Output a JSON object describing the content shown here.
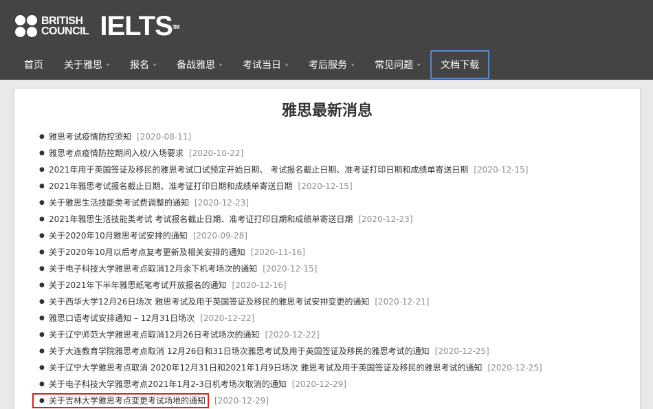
{
  "header": {
    "brand_line1": "BRITISH",
    "brand_line2": "COUNCIL",
    "product": "IELTS",
    "tm": "TM"
  },
  "nav": {
    "items": [
      {
        "label": "首页",
        "dropdown": false
      },
      {
        "label": "关于雅思",
        "dropdown": true
      },
      {
        "label": "报名",
        "dropdown": true
      },
      {
        "label": "备战雅思",
        "dropdown": true
      },
      {
        "label": "考试当日",
        "dropdown": true
      },
      {
        "label": "考后服务",
        "dropdown": true
      },
      {
        "label": "常见问题",
        "dropdown": true
      },
      {
        "label": "文档下载",
        "dropdown": false,
        "active": true
      }
    ]
  },
  "main": {
    "title": "雅思最新消息",
    "news": [
      {
        "title": "雅思考试疫情防控须知",
        "date": "[2020-08-11]"
      },
      {
        "title": "雅思考点疫情防控期间入校/入场要求",
        "date": "[2020-10-22]"
      },
      {
        "title": "2021年用于英国签证及移民的雅思考试口试预定开始日期、 考试报名截止日期、准考证打印日期和成绩单寄送日期",
        "date": "[2020-12-15]"
      },
      {
        "title": "2021年雅思考试报名截止日期、准考证打印日期和成绩单寄送日期",
        "date": "[2020-12-15]"
      },
      {
        "title": "关于雅思生活技能类考试费调整的通知",
        "date": "[2020-12-23]"
      },
      {
        "title": "2021年雅思生活技能类考试 考试报名截止日期、准考证打印日期和成绩单寄送日期",
        "date": "[2020-12-23]"
      },
      {
        "title": "关于2020年10月雅思考试安排的通知",
        "date": "[2020-09-28]"
      },
      {
        "title": "关于2020年10月以后考点复考更新及相关安排的通知",
        "date": "[2020-11-16]"
      },
      {
        "title": "关于电子科技大学雅思考点取消12月余下机考场次的通知",
        "date": "[2020-12-15]"
      },
      {
        "title": "关于2021年下半年雅思纸笔考试开放报名的通知",
        "date": "[2020-12-16]"
      },
      {
        "title": "关于西华大学12月26日场次 雅思考试及用于英国签证及移民的雅思考试安排变更的通知",
        "date": "[2020-12-21]"
      },
      {
        "title": "雅思口语考试安排通知 – 12月31日场次",
        "date": "[2020-12-22]"
      },
      {
        "title": "关于辽宁师范大学雅思考点取消12月26日考试场次的通知",
        "date": "[2020-12-22]"
      },
      {
        "title": "关于大连教育学院雅思考点取消 12月26日和31日场次雅思考试及用于英国签证及移民的雅思考试的通知",
        "date": "[2020-12-25]"
      },
      {
        "title": "关于辽宁大学雅思考点取消 2020年12月31日和2021年1月9日场次 雅思考试及用于英国签证及移民的雅思考试的通知",
        "date": "[2020-12-25]"
      },
      {
        "title": "关于电子科技大学雅思考点2021年1月2-3日机考场次取消的通知",
        "date": "[2020-12-29]"
      },
      {
        "title": "关于吉林大学雅思考点变更考试场地的通知",
        "date": "[2020-12-29]",
        "highlighted": true
      }
    ]
  },
  "colors": {
    "header_bg": "#444444",
    "highlight_border": "#d9221c",
    "active_nav_border": "#5b86c7",
    "date_text": "#8d8d8d"
  }
}
